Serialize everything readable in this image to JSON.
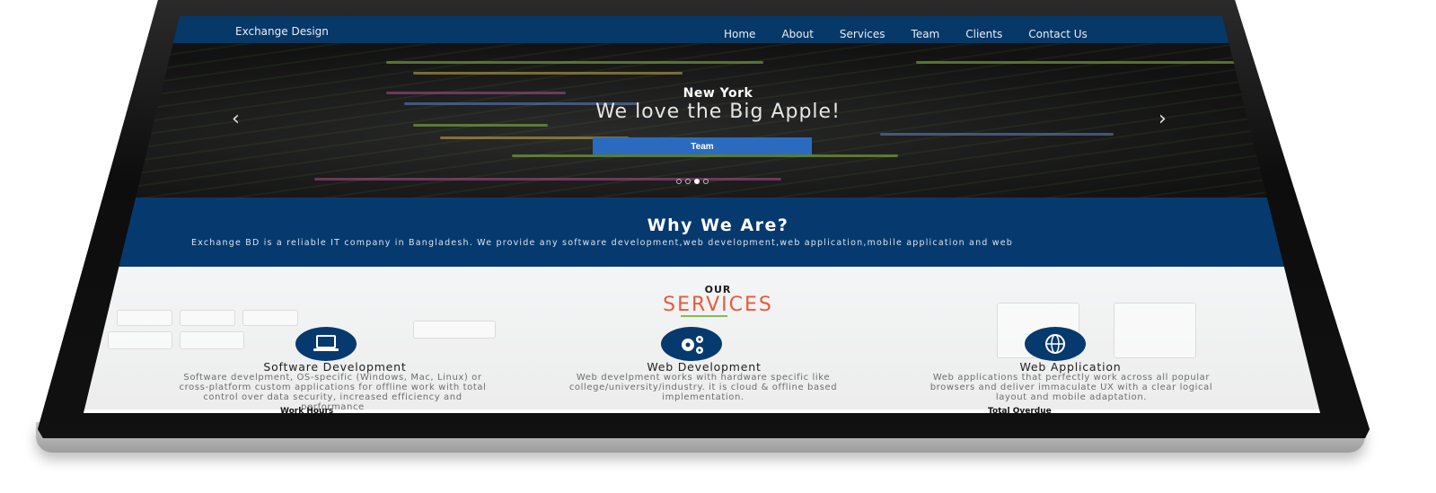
{
  "navbar": {
    "brand": "Exchange Design",
    "links": [
      "Home",
      "About",
      "Services",
      "Team",
      "Clients",
      "Contact Us"
    ]
  },
  "hero": {
    "subtitle": "New York",
    "title": "We love the Big Apple!",
    "button": "Team",
    "prev_icon": "chevron-left-icon",
    "next_icon": "chevron-right-icon",
    "slide_count": 4,
    "active_slide": 3
  },
  "why": {
    "title": "Why We Are?",
    "text": "Exchange BD is a reliable IT company in Bangladesh. We provide any software development,web development,web application,mobile application and web"
  },
  "services": {
    "eyebrow": "OUR",
    "title": "SERVICES",
    "items": [
      {
        "icon": "laptop-icon",
        "name": "Software Development",
        "desc": "Software develpment, OS-specific (Windows, Mac, Linux) or cross-platform custom applications for offline work with total control over data security, increased efficiency and performance"
      },
      {
        "icon": "gears-icon",
        "name": "Web Development",
        "desc": "Web develpment works with hardware specific like college/university/industry. it is cloud & offline based implementation."
      },
      {
        "icon": "globe-icon",
        "name": "Web Application",
        "desc": "Web applications that perfectly work across all popular browsers and deliver immaculate UX with a clear logical layout and mobile adaptation."
      }
    ]
  },
  "bottom": {
    "left_label": "Work Hours",
    "right_label": "Total Overdue"
  },
  "colors": {
    "navbar": "#063868",
    "why_band": "#063a6e",
    "accent_red": "#e65a3f",
    "accent_green": "#7fbf59",
    "button": "#2b6bbf"
  }
}
